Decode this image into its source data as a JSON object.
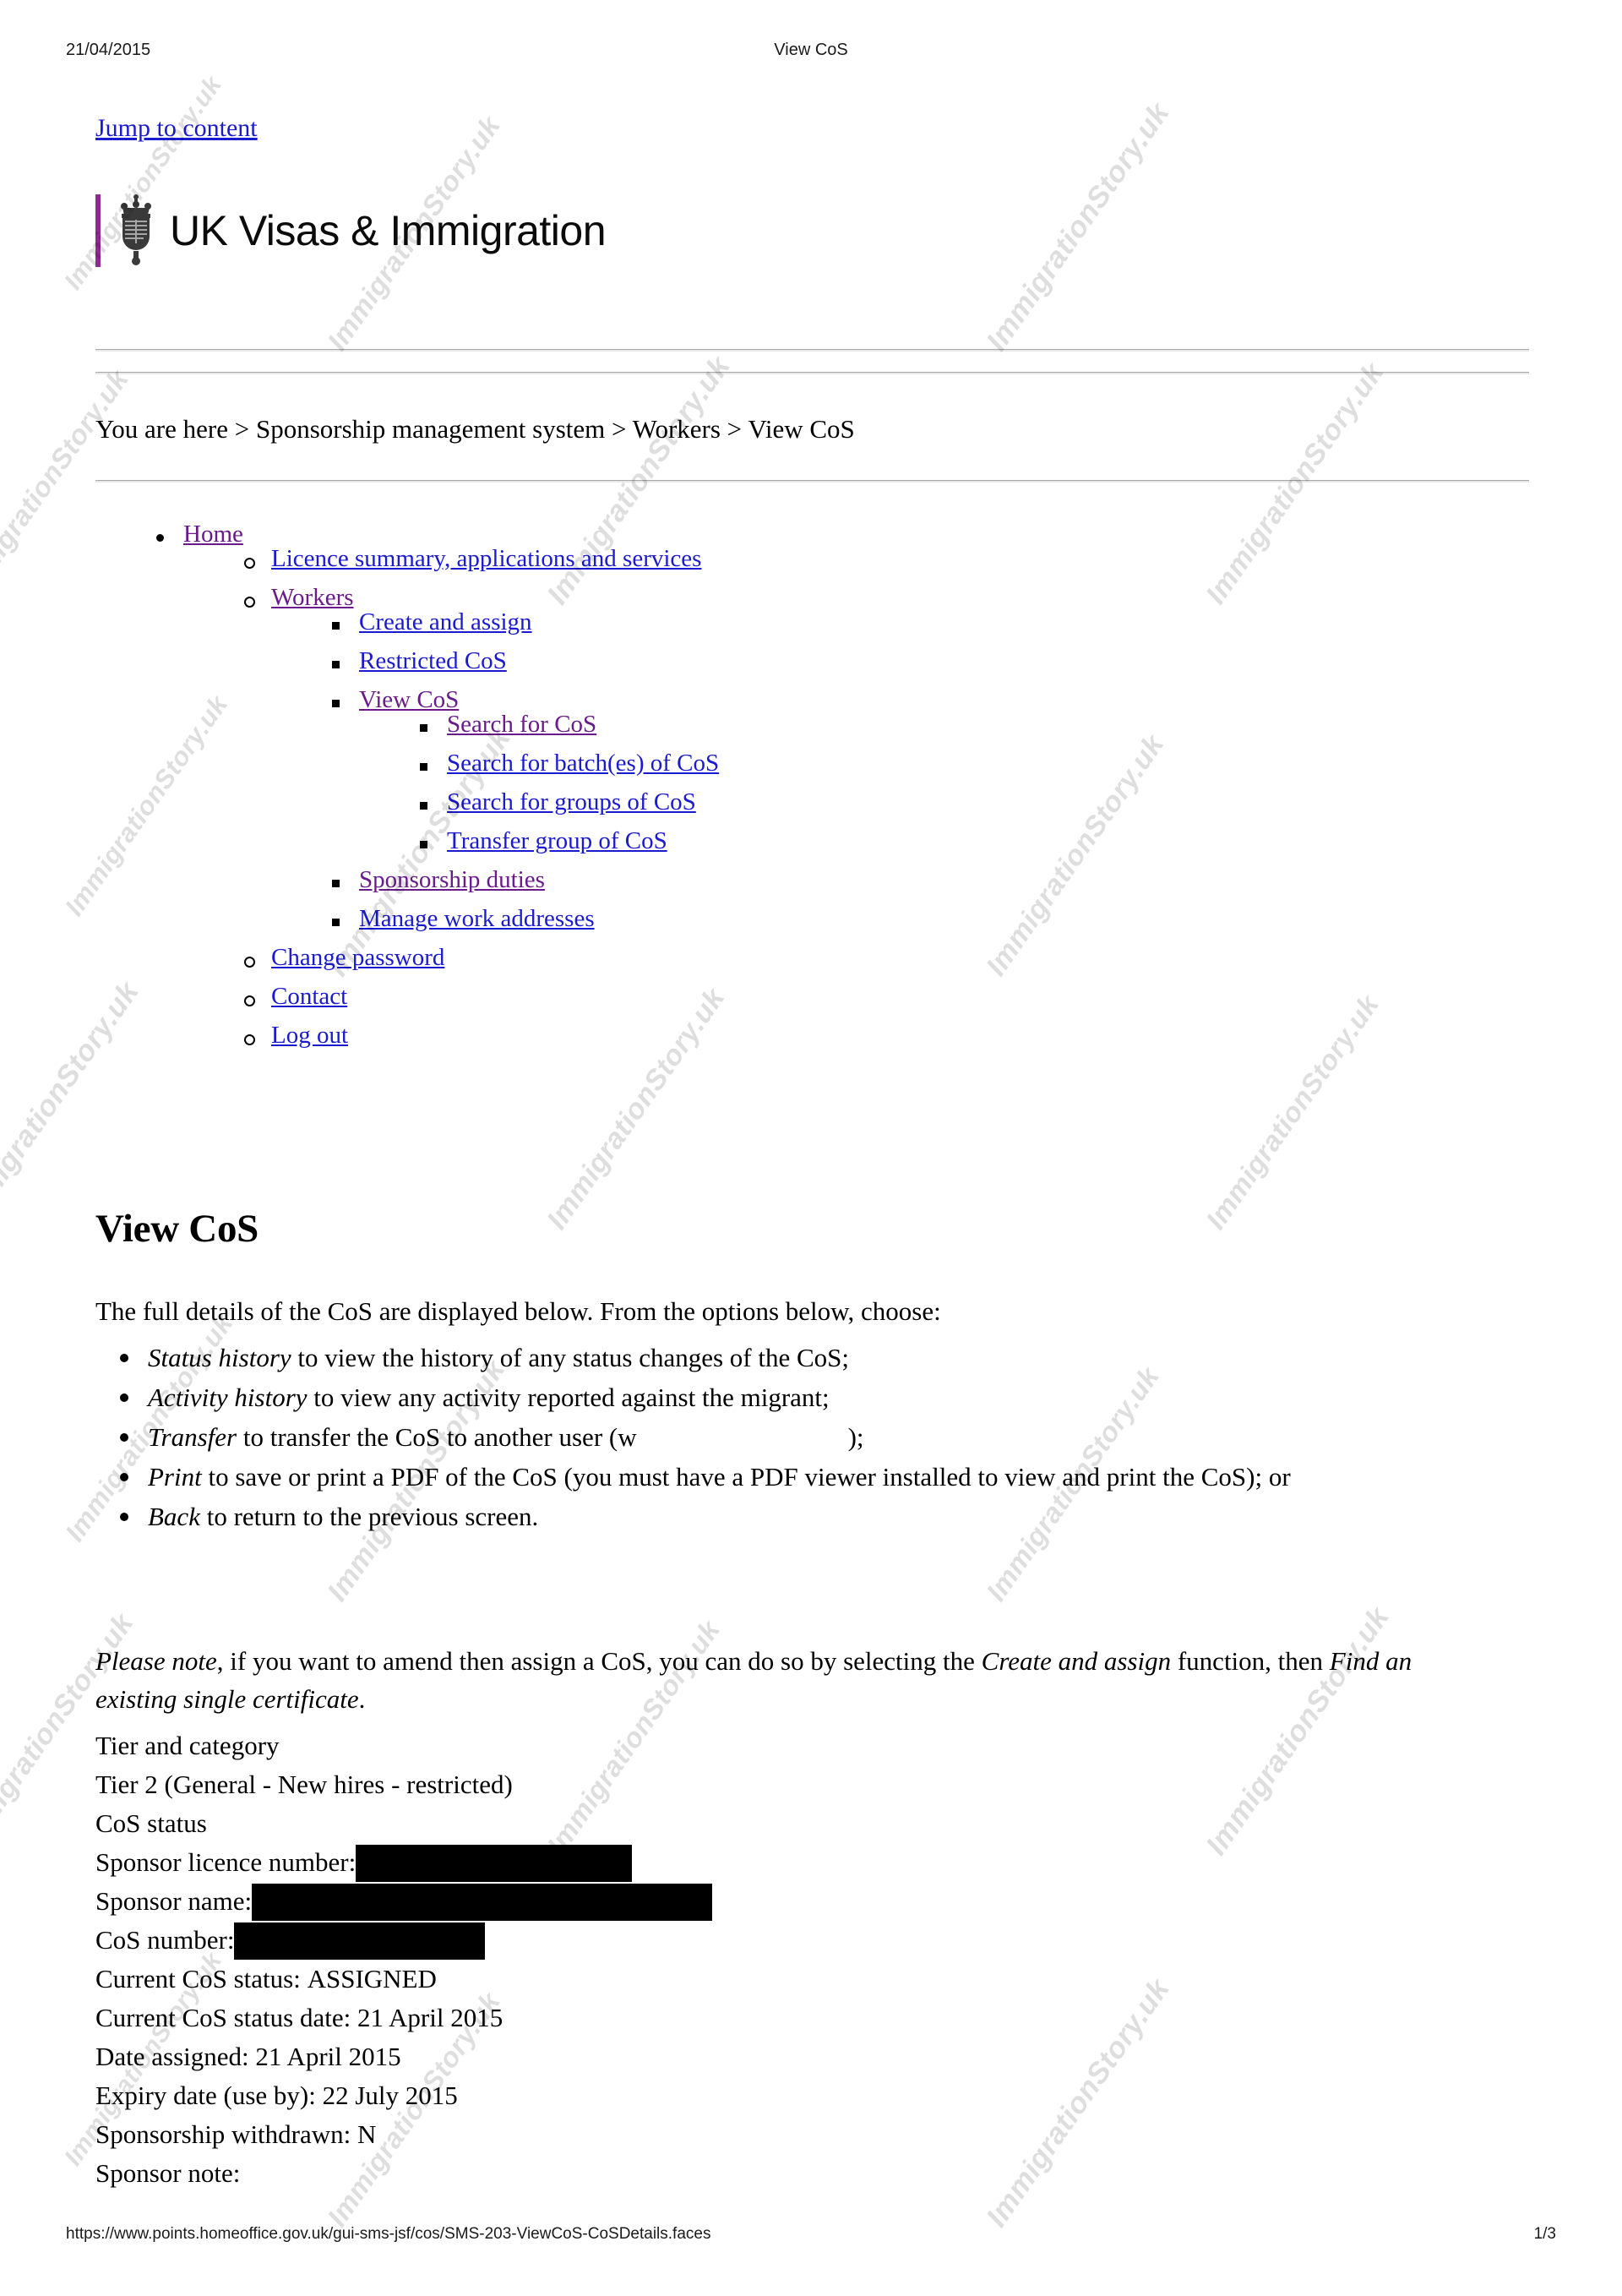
{
  "print_header": {
    "date": "21/04/2015",
    "title": "View CoS"
  },
  "jump_link": "Jump to content",
  "brand": {
    "crest_icon": "royal-crest-icon",
    "title": "UK Visas & Immigration",
    "accent_color": "#8f2a8f"
  },
  "breadcrumb": "You are here > Sponsorship management system > Workers > View CoS",
  "nav": {
    "home": "Home",
    "licence_summary": "Licence summary, applications and services",
    "workers": "Workers",
    "create_and_assign": "Create and assign",
    "restricted_cos": "Restricted CoS",
    "view_cos": "View CoS",
    "search_for_cos": "Search for CoS",
    "search_for_batches": "Search for batch(es) of CoS",
    "search_for_groups": "Search for groups of CoS",
    "transfer_group": "Transfer group of CoS",
    "sponsorship_duties": "Sponsorship duties",
    "manage_work_addresses": "Manage work addresses",
    "change_password": "Change password",
    "contact": "Contact",
    "log_out": "Log out"
  },
  "main": {
    "heading": "View CoS",
    "intro": "The full details of the CoS are displayed below. From the options below, choose:",
    "options": [
      {
        "term": "Status history",
        "rest": " to view the history of any status changes of the CoS;"
      },
      {
        "term": "Activity history",
        "rest": " to view any activity reported against the migrant;"
      },
      {
        "term": "Transfer",
        "rest_before": " to transfer the CoS to another user (w",
        "rest_after": ");"
      },
      {
        "term": "Print",
        "rest": " to save or print a PDF of the CoS (you must have a PDF viewer installed to view and print the CoS); or"
      },
      {
        "term": "Back",
        "rest": " to return to the previous screen."
      }
    ],
    "note": {
      "lead": "Please note",
      "part1": ", if you want to amend then assign a CoS, you can do so by selecting the ",
      "em1": "Create and assign",
      "part2": " function, then ",
      "em2": "Find an existing single certificate",
      "part3": "."
    }
  },
  "details": {
    "tier_label": "Tier and category",
    "tier_value": "Tier 2 (General - New hires - restricted)",
    "cos_status_label": "CoS status",
    "sponsor_licence_label": "Sponsor licence number:",
    "sponsor_licence_value": "",
    "sponsor_name_label": "Sponsor name:",
    "sponsor_name_value": "",
    "cos_number_label": "CoS number:",
    "cos_number_value": "",
    "current_status_label": "Current CoS status:",
    "current_status_value": "ASSIGNED",
    "current_status_date_label": "Current CoS status date:",
    "current_status_date_value": "21 April 2015",
    "date_assigned_label": "Date assigned:",
    "date_assigned_value": "21 April 2015",
    "expiry_label": "Expiry date (use by):",
    "expiry_value": "22 July 2015",
    "withdrawn_label": "Sponsorship withdrawn:",
    "withdrawn_value": "N",
    "sponsor_note_label": "Sponsor note:",
    "sponsor_note_value": ""
  },
  "footer": {
    "url": "https://www.points.homeoffice.gov.uk/gui-sms-jsf/cos/SMS-203-ViewCoS-CoSDetails.faces",
    "page": "1/3"
  },
  "watermark": {
    "text": "ImmigrationStory.uk"
  }
}
